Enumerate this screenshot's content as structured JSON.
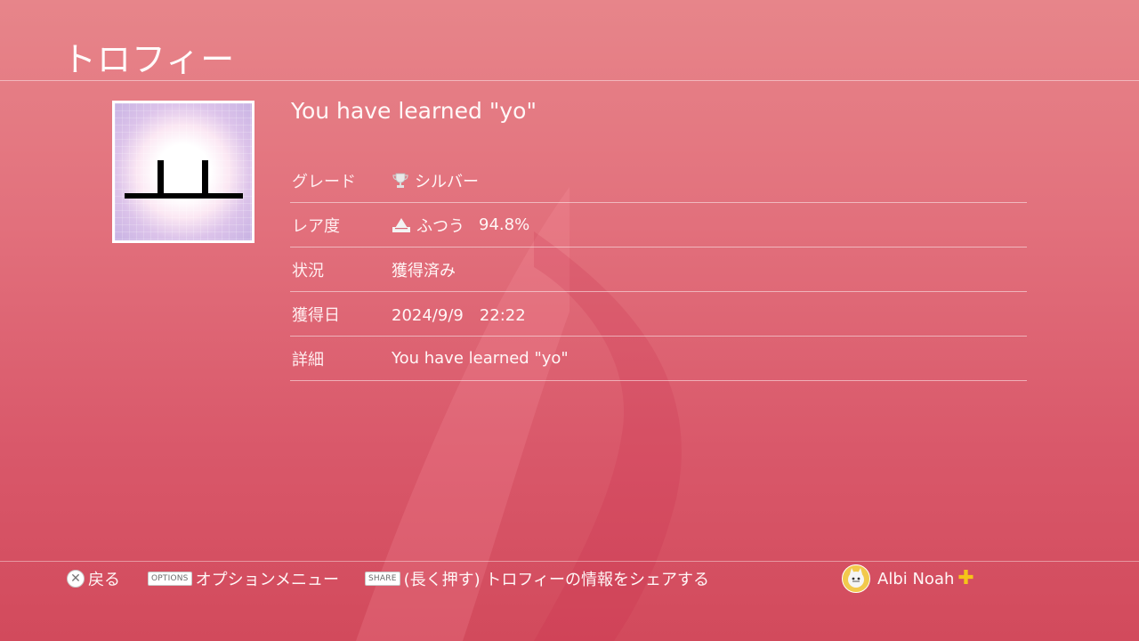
{
  "header": {
    "title": "トロフィー"
  },
  "trophy": {
    "name": "You have learned \"yo\"",
    "icon_glyph": "ㅛ",
    "details": [
      {
        "label": "グレード",
        "icon": "trophy-icon",
        "value": "シルバー"
      },
      {
        "label": "レア度",
        "icon": "rarity-icon",
        "value": "ふつう",
        "percent": "94.8%"
      },
      {
        "label": "状況",
        "value": "獲得済み"
      },
      {
        "label": "獲得日",
        "value": "2024/9/9　22:22"
      },
      {
        "label": "詳細",
        "value": "You have learned \"yo\""
      }
    ]
  },
  "footer": {
    "back_label": "戻る",
    "options_key": "OPTIONS",
    "options_label": "オプションメニュー",
    "share_key": "SHARE",
    "share_label": "(長く押す) トロフィーの情報をシェアする",
    "user_name": "Albi Noah"
  },
  "colors": {
    "accent_plus": "#f5c518",
    "background": "#e07080"
  }
}
